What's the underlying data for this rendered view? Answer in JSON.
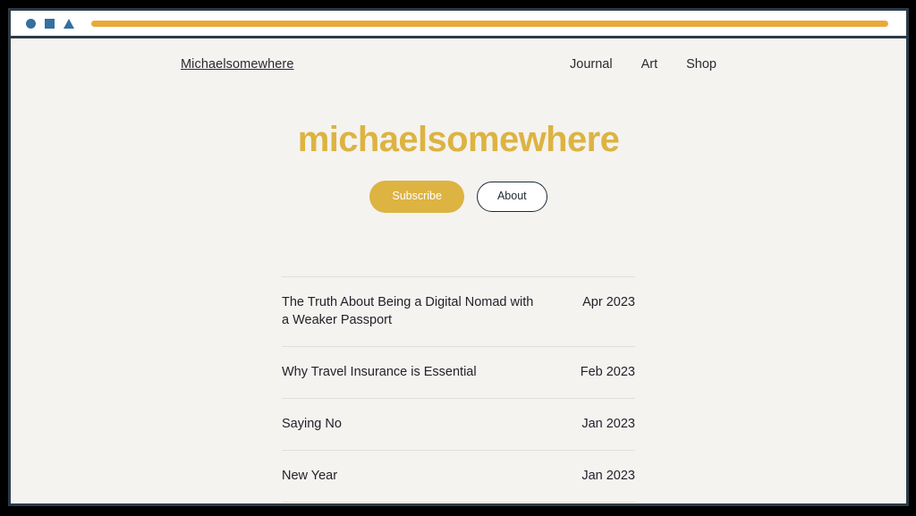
{
  "browser": {
    "controls": [
      {
        "icon": "circle-icon"
      },
      {
        "icon": "square-icon"
      },
      {
        "icon": "triangle-icon"
      }
    ],
    "address_bar_value": "",
    "accent_color": "#e9a93a",
    "control_color": "#35709e",
    "frame_color": "#2b3a47"
  },
  "site": {
    "background_color": "#f4f3f0",
    "brand": "Michaelsomewhere",
    "nav": [
      {
        "label": "Journal"
      },
      {
        "label": "Art"
      },
      {
        "label": "Shop"
      }
    ],
    "hero": {
      "title": "michaelsomewhere",
      "title_color": "#ddb341",
      "subscribe_label": "Subscribe",
      "about_label": "About"
    },
    "posts": [
      {
        "title": "The Truth About Being a Digital Nomad with a Weaker Passport",
        "date": "Apr 2023"
      },
      {
        "title": "Why Travel Insurance is Essential",
        "date": "Feb 2023"
      },
      {
        "title": "Saying No",
        "date": "Jan 2023"
      },
      {
        "title": "New Year",
        "date": "Jan 2023"
      }
    ]
  }
}
